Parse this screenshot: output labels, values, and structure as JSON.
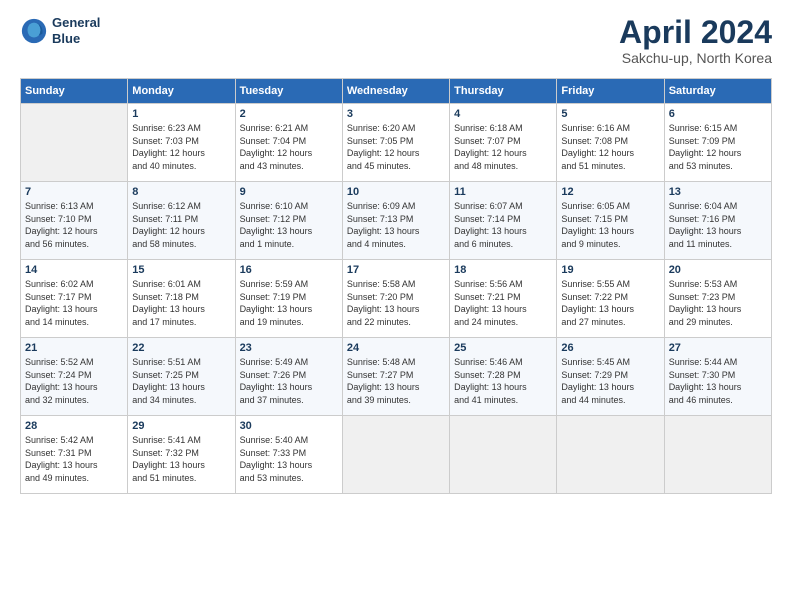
{
  "header": {
    "logo_line1": "General",
    "logo_line2": "Blue",
    "title": "April 2024",
    "location": "Sakchu-up, North Korea"
  },
  "weekdays": [
    "Sunday",
    "Monday",
    "Tuesday",
    "Wednesday",
    "Thursday",
    "Friday",
    "Saturday"
  ],
  "weeks": [
    [
      {
        "day": "",
        "info": ""
      },
      {
        "day": "1",
        "info": "Sunrise: 6:23 AM\nSunset: 7:03 PM\nDaylight: 12 hours\nand 40 minutes."
      },
      {
        "day": "2",
        "info": "Sunrise: 6:21 AM\nSunset: 7:04 PM\nDaylight: 12 hours\nand 43 minutes."
      },
      {
        "day": "3",
        "info": "Sunrise: 6:20 AM\nSunset: 7:05 PM\nDaylight: 12 hours\nand 45 minutes."
      },
      {
        "day": "4",
        "info": "Sunrise: 6:18 AM\nSunset: 7:07 PM\nDaylight: 12 hours\nand 48 minutes."
      },
      {
        "day": "5",
        "info": "Sunrise: 6:16 AM\nSunset: 7:08 PM\nDaylight: 12 hours\nand 51 minutes."
      },
      {
        "day": "6",
        "info": "Sunrise: 6:15 AM\nSunset: 7:09 PM\nDaylight: 12 hours\nand 53 minutes."
      }
    ],
    [
      {
        "day": "7",
        "info": "Sunrise: 6:13 AM\nSunset: 7:10 PM\nDaylight: 12 hours\nand 56 minutes."
      },
      {
        "day": "8",
        "info": "Sunrise: 6:12 AM\nSunset: 7:11 PM\nDaylight: 12 hours\nand 58 minutes."
      },
      {
        "day": "9",
        "info": "Sunrise: 6:10 AM\nSunset: 7:12 PM\nDaylight: 13 hours\nand 1 minute."
      },
      {
        "day": "10",
        "info": "Sunrise: 6:09 AM\nSunset: 7:13 PM\nDaylight: 13 hours\nand 4 minutes."
      },
      {
        "day": "11",
        "info": "Sunrise: 6:07 AM\nSunset: 7:14 PM\nDaylight: 13 hours\nand 6 minutes."
      },
      {
        "day": "12",
        "info": "Sunrise: 6:05 AM\nSunset: 7:15 PM\nDaylight: 13 hours\nand 9 minutes."
      },
      {
        "day": "13",
        "info": "Sunrise: 6:04 AM\nSunset: 7:16 PM\nDaylight: 13 hours\nand 11 minutes."
      }
    ],
    [
      {
        "day": "14",
        "info": "Sunrise: 6:02 AM\nSunset: 7:17 PM\nDaylight: 13 hours\nand 14 minutes."
      },
      {
        "day": "15",
        "info": "Sunrise: 6:01 AM\nSunset: 7:18 PM\nDaylight: 13 hours\nand 17 minutes."
      },
      {
        "day": "16",
        "info": "Sunrise: 5:59 AM\nSunset: 7:19 PM\nDaylight: 13 hours\nand 19 minutes."
      },
      {
        "day": "17",
        "info": "Sunrise: 5:58 AM\nSunset: 7:20 PM\nDaylight: 13 hours\nand 22 minutes."
      },
      {
        "day": "18",
        "info": "Sunrise: 5:56 AM\nSunset: 7:21 PM\nDaylight: 13 hours\nand 24 minutes."
      },
      {
        "day": "19",
        "info": "Sunrise: 5:55 AM\nSunset: 7:22 PM\nDaylight: 13 hours\nand 27 minutes."
      },
      {
        "day": "20",
        "info": "Sunrise: 5:53 AM\nSunset: 7:23 PM\nDaylight: 13 hours\nand 29 minutes."
      }
    ],
    [
      {
        "day": "21",
        "info": "Sunrise: 5:52 AM\nSunset: 7:24 PM\nDaylight: 13 hours\nand 32 minutes."
      },
      {
        "day": "22",
        "info": "Sunrise: 5:51 AM\nSunset: 7:25 PM\nDaylight: 13 hours\nand 34 minutes."
      },
      {
        "day": "23",
        "info": "Sunrise: 5:49 AM\nSunset: 7:26 PM\nDaylight: 13 hours\nand 37 minutes."
      },
      {
        "day": "24",
        "info": "Sunrise: 5:48 AM\nSunset: 7:27 PM\nDaylight: 13 hours\nand 39 minutes."
      },
      {
        "day": "25",
        "info": "Sunrise: 5:46 AM\nSunset: 7:28 PM\nDaylight: 13 hours\nand 41 minutes."
      },
      {
        "day": "26",
        "info": "Sunrise: 5:45 AM\nSunset: 7:29 PM\nDaylight: 13 hours\nand 44 minutes."
      },
      {
        "day": "27",
        "info": "Sunrise: 5:44 AM\nSunset: 7:30 PM\nDaylight: 13 hours\nand 46 minutes."
      }
    ],
    [
      {
        "day": "28",
        "info": "Sunrise: 5:42 AM\nSunset: 7:31 PM\nDaylight: 13 hours\nand 49 minutes."
      },
      {
        "day": "29",
        "info": "Sunrise: 5:41 AM\nSunset: 7:32 PM\nDaylight: 13 hours\nand 51 minutes."
      },
      {
        "day": "30",
        "info": "Sunrise: 5:40 AM\nSunset: 7:33 PM\nDaylight: 13 hours\nand 53 minutes."
      },
      {
        "day": "",
        "info": ""
      },
      {
        "day": "",
        "info": ""
      },
      {
        "day": "",
        "info": ""
      },
      {
        "day": "",
        "info": ""
      }
    ]
  ]
}
